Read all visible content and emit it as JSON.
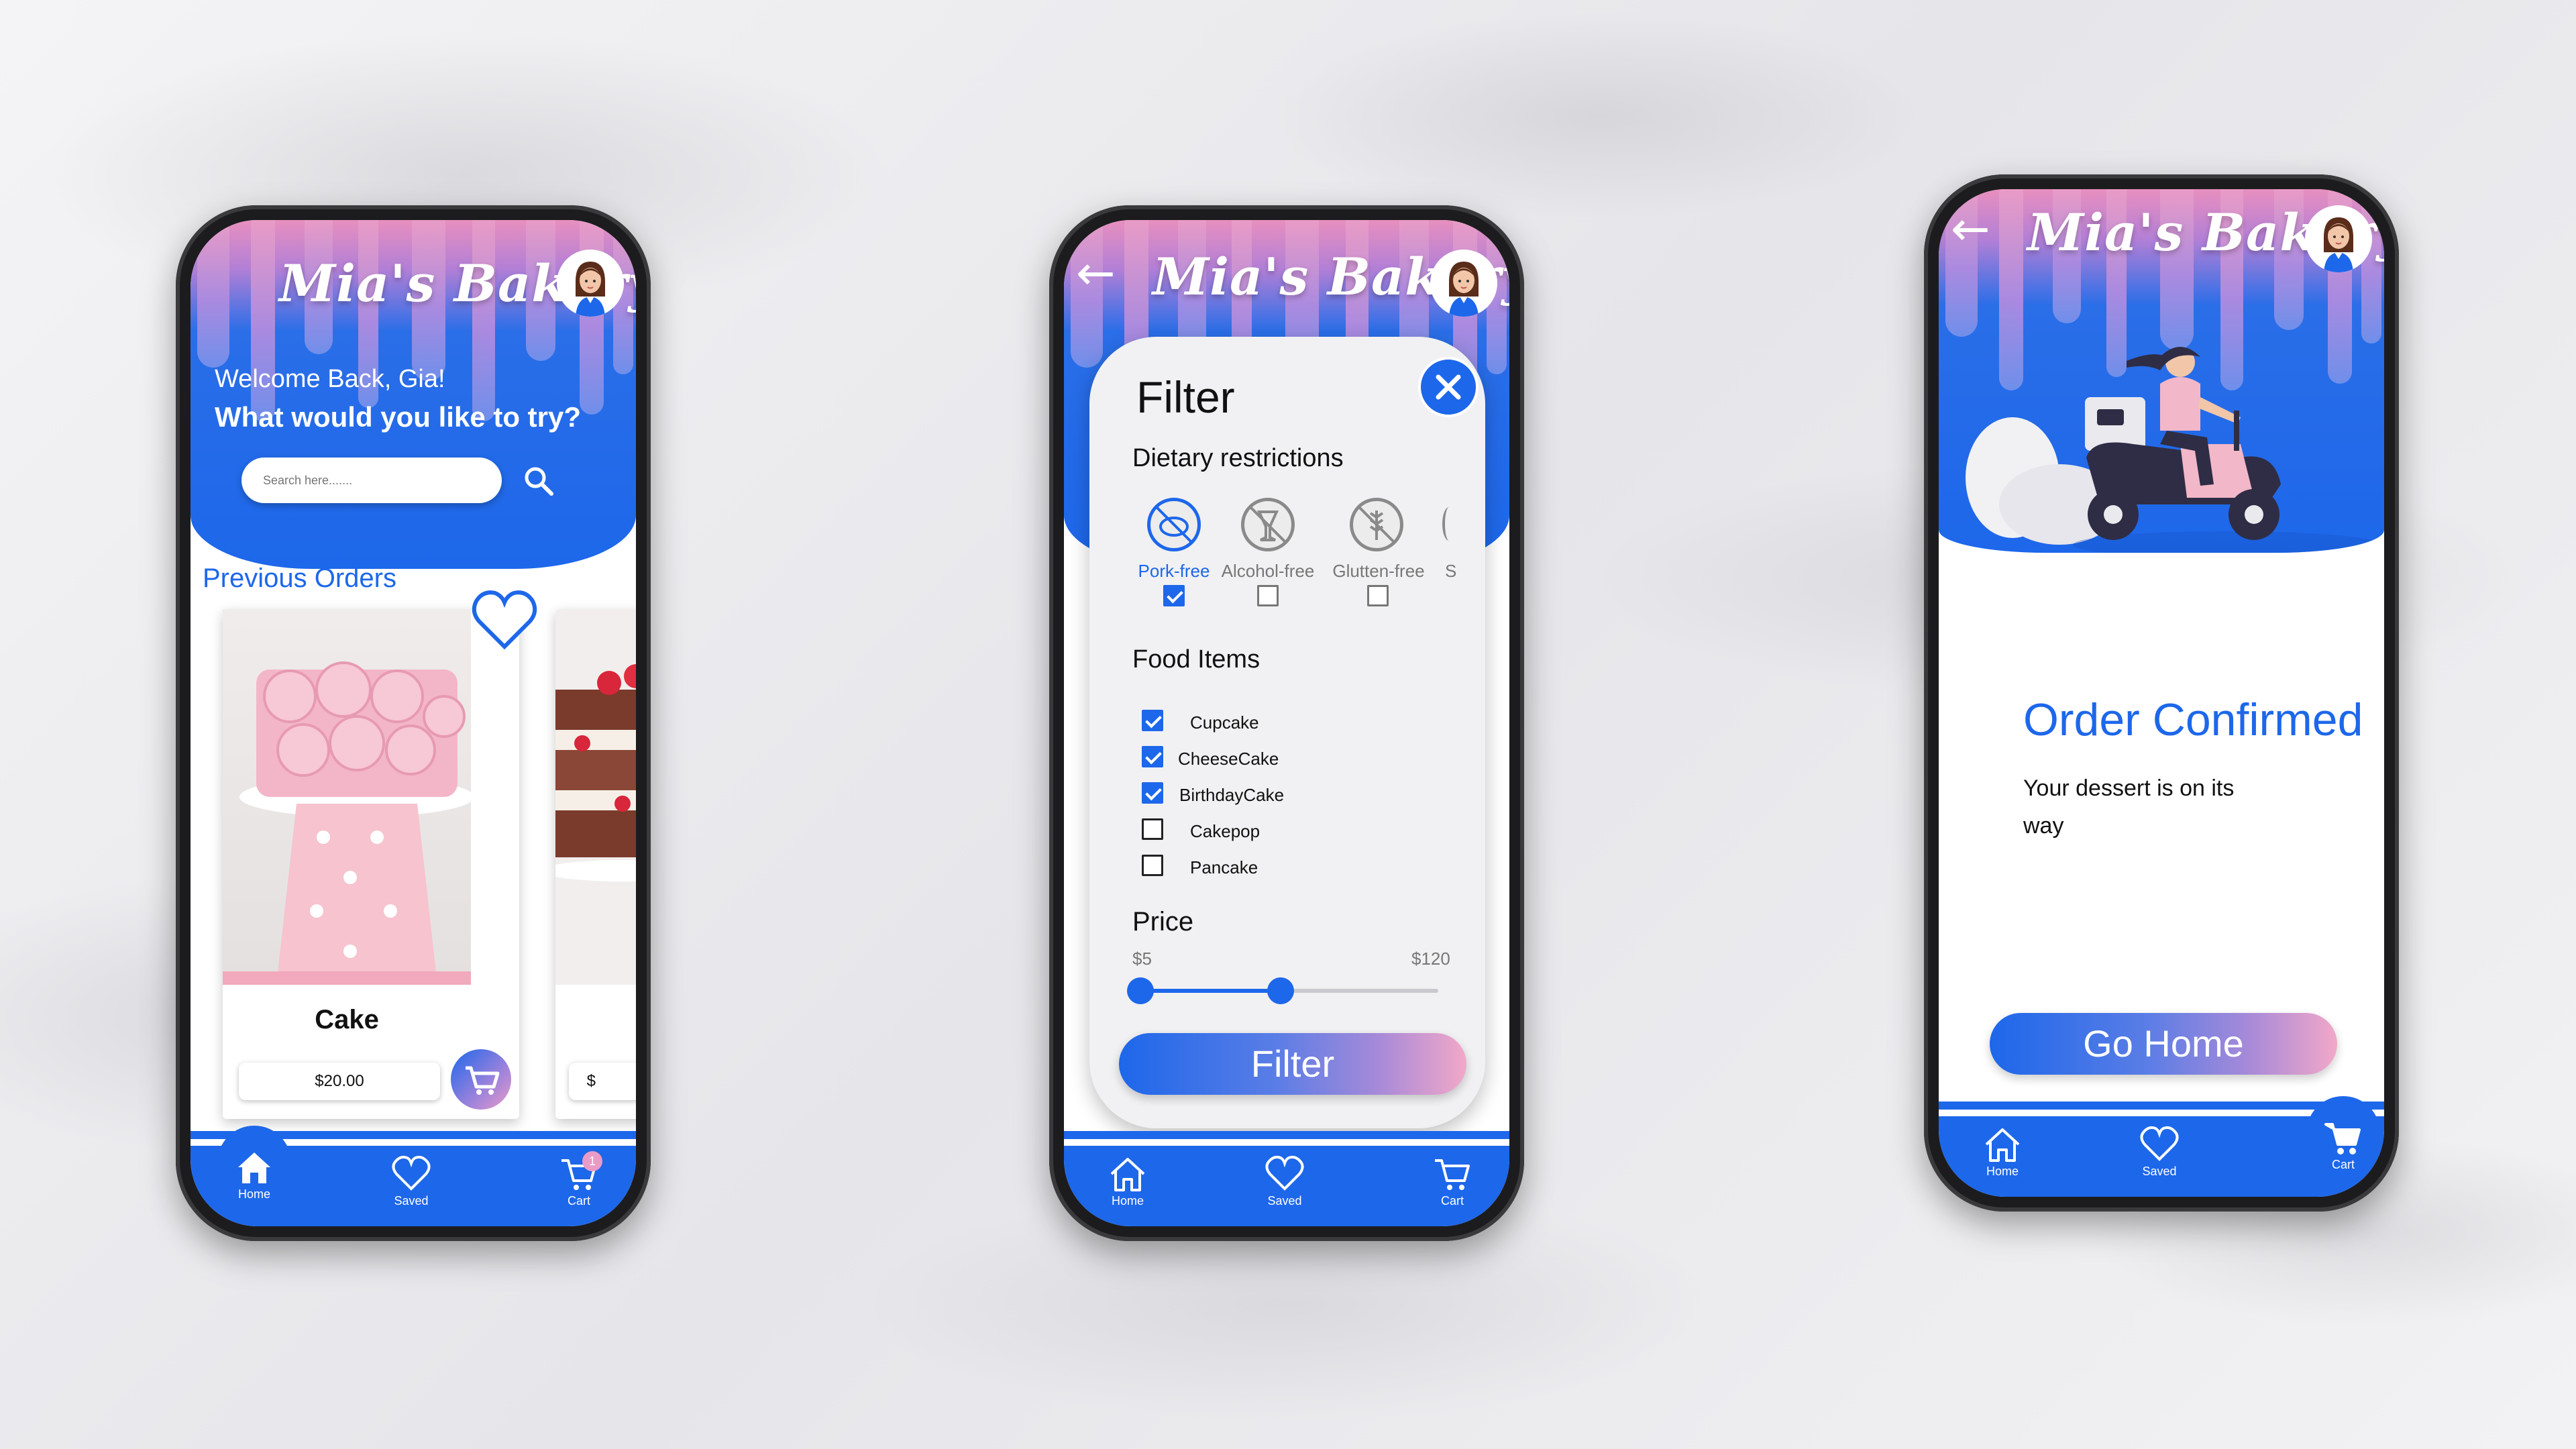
{
  "brand": "Mia's Bakery",
  "colors": {
    "primary": "#1d67ea",
    "pink": "#e99bc6",
    "lavender": "#a98ae0"
  },
  "nav": {
    "home": "Home",
    "saved": "Saved",
    "cart": "Cart",
    "cart_badge": "1"
  },
  "screen1": {
    "welcome": "Welcome Back, Gia!",
    "prompt": "What would you like to try?",
    "search_placeholder": "Search here.......",
    "section_title": "Previous Orders",
    "card": {
      "name": "Cake",
      "price": "$20.00"
    },
    "second_card_price": "$"
  },
  "screen2": {
    "title": "Filter",
    "dietary_title": "Dietary restrictions",
    "dietary": [
      {
        "label": "Pork-free",
        "icon": "pork-free-icon",
        "checked": true
      },
      {
        "label": "Alcohol-free",
        "icon": "alcohol-free-icon",
        "checked": false
      },
      {
        "label": "Glutten-free",
        "icon": "gluten-free-icon",
        "checked": false
      },
      {
        "label": "S",
        "icon": "partial-icon",
        "checked": false
      }
    ],
    "food_title": "Food Items",
    "food_items": [
      {
        "label": "Cupcake",
        "checked": true
      },
      {
        "label": "CheeseCake",
        "checked": true
      },
      {
        "label": "BirthdayCake",
        "checked": true
      },
      {
        "label": "Cakepop",
        "checked": false
      },
      {
        "label": "Pancake",
        "checked": false
      }
    ],
    "price_title": "Price",
    "price_min": "$5",
    "price_max": "$120",
    "price_selected_fraction": [
      0.0,
      0.47
    ],
    "filter_button": "Filter"
  },
  "screen3": {
    "title": "Order Confirmed",
    "message_line1": "Your dessert is on its",
    "message_line2": "way",
    "button": "Go Home"
  }
}
